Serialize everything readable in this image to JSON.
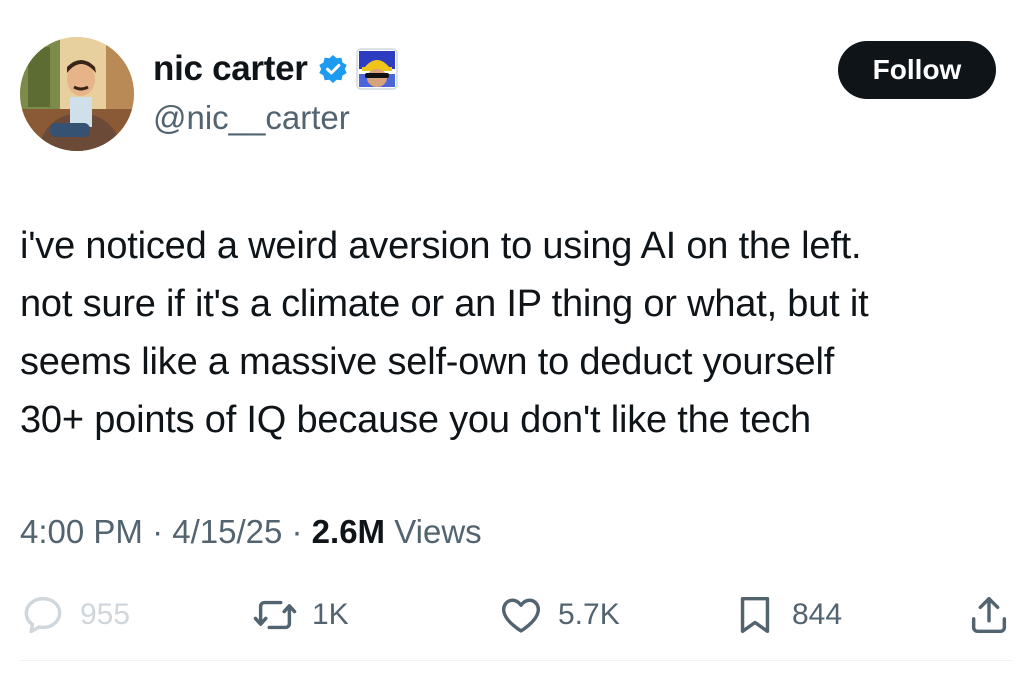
{
  "author": {
    "display_name": "nic carter",
    "handle": "@nic__carter",
    "verified_icon": "verified-badge-icon",
    "affiliate_icon": "affiliate-badge-icon"
  },
  "follow_button": {
    "label": "Follow"
  },
  "tweet": {
    "text": "i've noticed a weird aversion to using AI on the left.\nnot sure if it's a climate or an IP thing or what, but it\nseems like a massive self-own to deduct yourself\n30+ points of IQ because you don't like the tech"
  },
  "meta": {
    "time": "4:00 PM",
    "separator": " · ",
    "date": "4/15/25",
    "views_count": "2.6M",
    "views_label": " Views"
  },
  "actions": {
    "replies": {
      "icon": "reply-icon",
      "count": "955"
    },
    "reposts": {
      "icon": "repost-icon",
      "count": "1K"
    },
    "likes": {
      "icon": "heart-icon",
      "count": "5.7K"
    },
    "bookmarks": {
      "icon": "bookmark-icon",
      "count": "844"
    },
    "share": {
      "icon": "share-icon"
    }
  },
  "colors": {
    "text_primary": "#0f1419",
    "text_secondary": "#536471",
    "verified_blue": "#1d9bf0",
    "button_bg": "#0f1419",
    "faded": "#cfd6dc"
  }
}
